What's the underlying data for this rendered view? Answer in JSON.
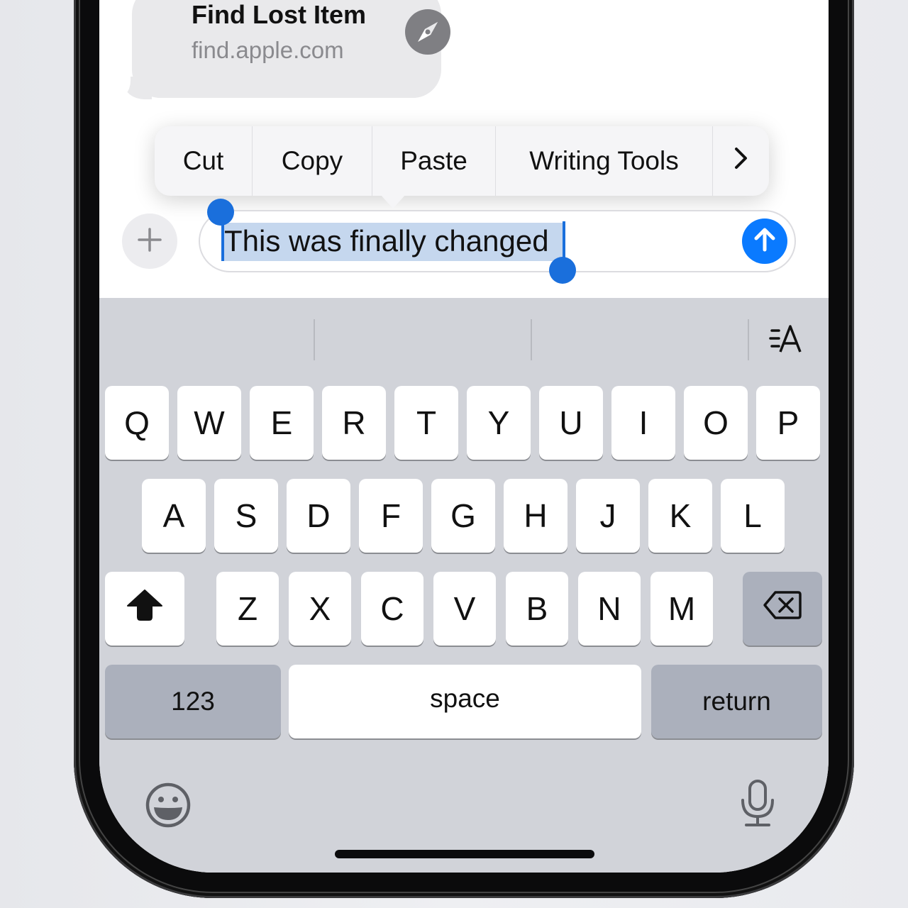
{
  "message": {
    "title": "Find Lost Item",
    "url": "find.apple.com",
    "icon": "compass-icon"
  },
  "edit_menu": {
    "items": [
      {
        "label": "Cut"
      },
      {
        "label": "Copy"
      },
      {
        "label": "Paste"
      },
      {
        "label": "Writing Tools"
      },
      {
        "label": "›",
        "icon": "chevron-right-icon"
      }
    ]
  },
  "composer": {
    "add_icon": "plus-icon",
    "text": "This was finally changed",
    "selected_text": "This was finally changed",
    "send_icon": "arrow-up-icon",
    "colors": {
      "accent": "#0a7aff",
      "selection": "#c5d7ee",
      "handles": "#1a6fdc"
    }
  },
  "keyboard": {
    "format_label": "=A",
    "row1": [
      "Q",
      "W",
      "E",
      "R",
      "T",
      "Y",
      "U",
      "I",
      "O",
      "P"
    ],
    "row2": [
      "A",
      "S",
      "D",
      "F",
      "G",
      "H",
      "J",
      "K",
      "L"
    ],
    "row3": [
      "Z",
      "X",
      "C",
      "V",
      "B",
      "N",
      "M"
    ],
    "shift_icon": "shift-icon",
    "delete_icon": "delete-icon",
    "numbers_label": "123",
    "space_label": "space",
    "return_label": "return",
    "emoji_icon": "emoji-icon",
    "mic_icon": "microphone-icon",
    "colors": {
      "background": "#d1d3d9",
      "key": "#ffffff",
      "special_key": "#abb0bc"
    }
  }
}
